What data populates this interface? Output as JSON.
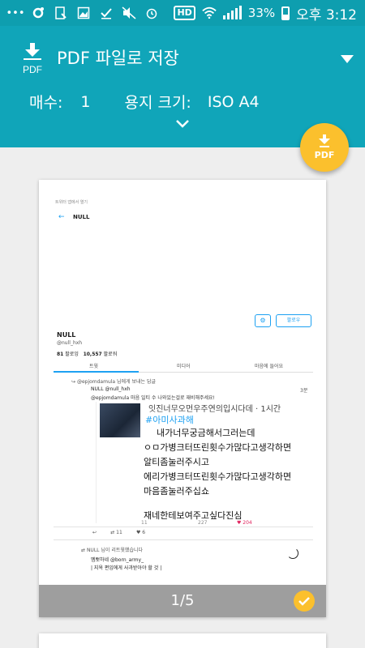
{
  "status_bar": {
    "battery": "33%",
    "time": "오후 3:12",
    "hd_label": "HD"
  },
  "header": {
    "title": "PDF 파일로 저장",
    "copies_label": "매수:",
    "copies_value": "1",
    "paper_label": "용지 크기:",
    "paper_value": "ISO A4"
  },
  "fab": {
    "label": "PDF"
  },
  "preview": {
    "page_counter": "1/5",
    "top_caption": "트위터 앱에서 열기",
    "nav_name": "NULL",
    "follow_label": "팔로우",
    "profile": {
      "name": "NULL",
      "handle": "@null_hxh",
      "following_count": "81",
      "following_label": "팔로잉",
      "followers_count": "10,557",
      "followers_label": "팔로워"
    },
    "tabs": [
      "트윗",
      "미디어",
      "마음에 들어요"
    ],
    "reply_context": "@epjomdamula 님에게 보내는 답글",
    "tweet_author": "NULL @null_hxh",
    "tweet_time": "3분",
    "tweet_text": "@epjomdamula 마음 일티 수 나와있는걸로 재비해주세요!",
    "image_lines": [
      "잇진너무오먼우주연의입시다데 · 1시간",
      "#아미사과해",
      "내가너무궁금해서그러는데",
      "ㅇㅁ가병크터뜨린횟수가많다고생각하면",
      "알티좀눌러주시고",
      "에리가병크터뜨린횟수가많다고생각하면",
      "마음좀눌러주십쇼",
      "",
      "재네한테보여주고싶다진심"
    ],
    "image_stats": [
      "11",
      "227",
      "204"
    ],
    "tweet_actions": [
      "11",
      "6"
    ],
    "retweet_note": "NULL 님이 리트윗했습니다",
    "retweet_author": "멤뽀하네 @born_army_",
    "retweet_text": "| 지옥 편임에게 사과받아야 할 것 |"
  },
  "colors": {
    "header": "#10a5b9",
    "status_bar": "#0e9eaf",
    "fab": "#fbc02d",
    "footer": "#9e9e9e"
  }
}
